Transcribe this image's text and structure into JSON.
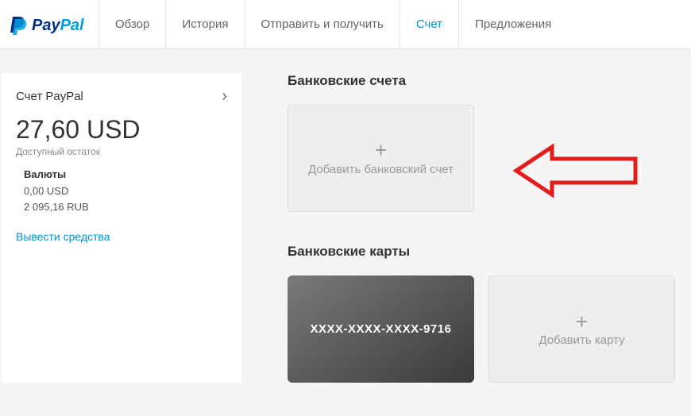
{
  "brand": "PayPal",
  "nav": {
    "items": [
      {
        "label": "Обзор"
      },
      {
        "label": "История"
      },
      {
        "label": "Отправить и получить"
      },
      {
        "label": "Счет",
        "active": true
      },
      {
        "label": "Предложения"
      }
    ]
  },
  "sidebar": {
    "account_title": "Счет PayPal",
    "balance": "27,60 USD",
    "balance_label": "Доступный остаток",
    "currencies_title": "Валюты",
    "currencies": [
      "0,00 USD",
      "2 095,16 RUB"
    ],
    "withdraw_label": "Вывести средства"
  },
  "main": {
    "bank_section_title": "Банковские счета",
    "add_bank_label": "Добавить банковский счет",
    "cards_section_title": "Банковские карты",
    "card_number": "XXXX-XXXX-XXXX-9716",
    "add_card_label": "Добавить карту"
  }
}
